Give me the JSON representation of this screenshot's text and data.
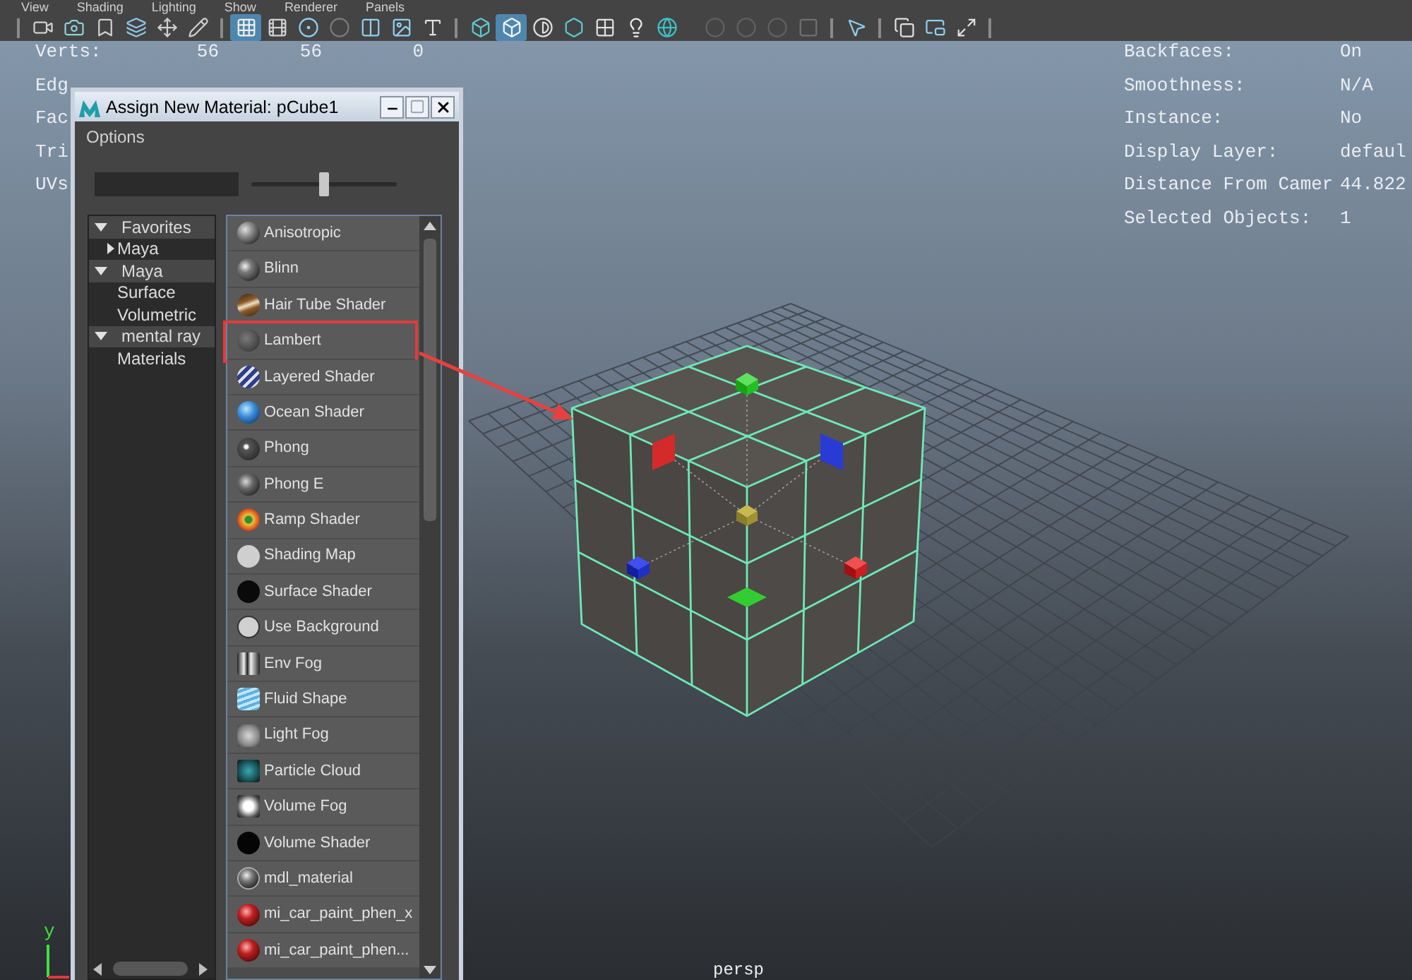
{
  "menu_bar": [
    "View",
    "Shading",
    "Lighting",
    "Show",
    "Renderer",
    "Panels"
  ],
  "toolbar": {
    "buttons": [
      {
        "on": false,
        "disabled": false
      },
      {
        "on": false,
        "disabled": false
      },
      {
        "on": false,
        "disabled": false
      },
      {
        "on": false,
        "disabled": false
      },
      {
        "on": false,
        "disabled": false
      },
      {
        "on": false,
        "disabled": false
      },
      {
        "on": true,
        "disabled": false
      },
      {
        "on": false,
        "disabled": false
      },
      {
        "on": false,
        "disabled": false
      },
      {
        "on": false,
        "disabled": false
      },
      {
        "on": false,
        "disabled": false
      },
      {
        "on": false,
        "disabled": false
      },
      {
        "on": false,
        "disabled": false
      },
      {
        "on": false,
        "disabled": false
      },
      {
        "on": true,
        "disabled": false
      },
      {
        "on": false,
        "disabled": false
      },
      {
        "on": false,
        "disabled": false
      },
      {
        "on": false,
        "disabled": false
      },
      {
        "on": false,
        "disabled": false
      },
      {
        "on": false,
        "disabled": false
      },
      {
        "on": false,
        "disabled": true
      },
      {
        "on": false,
        "disabled": true
      },
      {
        "on": false,
        "disabled": true
      },
      {
        "on": false,
        "disabled": false
      },
      {
        "on": false,
        "disabled": false
      },
      {
        "on": false,
        "disabled": false
      },
      {
        "on": false,
        "disabled": false
      },
      {
        "on": false,
        "disabled": false
      }
    ]
  },
  "viewport": {
    "hud_left": {
      "rows": [
        {
          "label": "Verts:",
          "values": [
            "56",
            "56",
            "0"
          ]
        },
        {
          "label": "Edg"
        },
        {
          "label": "Fac"
        },
        {
          "label": "Tri"
        },
        {
          "label": "UVs"
        }
      ]
    },
    "hud_right": {
      "rows": [
        {
          "label": "Backfaces:",
          "value": "On"
        },
        {
          "label": "Smoothness:",
          "value": "N/A"
        },
        {
          "label": "Instance:",
          "value": "No"
        },
        {
          "label": "Display Layer:",
          "value": "defaul"
        },
        {
          "label": "Distance From Camer",
          "value": "44.822"
        },
        {
          "label": "Selected Objects:",
          "value": "1"
        }
      ]
    },
    "axis_label": "y",
    "camera_label": "persp"
  },
  "dialog": {
    "title": "Assign New Material: pCube1",
    "menu": [
      "Options"
    ],
    "slider": {
      "level": 0.5
    },
    "tree": [
      {
        "label": "Favorites",
        "expanded": true,
        "children": [
          {
            "label": "Maya",
            "expanded": false
          }
        ]
      },
      {
        "label": "Maya",
        "expanded": true,
        "children": [
          {
            "label": "Surface"
          },
          {
            "label": "Volumetric"
          }
        ]
      },
      {
        "label": "mental ray",
        "expanded": true,
        "children": [
          {
            "label": "Materials"
          }
        ]
      }
    ],
    "materials": [
      {
        "label": "Anisotropic",
        "outlined": false
      },
      {
        "label": "Blinn",
        "outlined": false
      },
      {
        "label": "Hair Tube Shader",
        "outlined": false
      },
      {
        "label": "Lambert",
        "outlined": true
      },
      {
        "label": "Layered Shader",
        "outlined": false
      },
      {
        "label": "Ocean Shader",
        "outlined": false
      },
      {
        "label": "Phong",
        "outlined": false
      },
      {
        "label": "Phong E",
        "outlined": false
      },
      {
        "label": "Ramp Shader",
        "outlined": false
      },
      {
        "label": "Shading Map",
        "outlined": false
      },
      {
        "label": "Surface Shader",
        "outlined": false
      },
      {
        "label": "Use Background",
        "outlined": false
      },
      {
        "label": "Env Fog",
        "outlined": false
      },
      {
        "label": "Fluid Shape",
        "outlined": false
      },
      {
        "label": "Light Fog",
        "outlined": false
      },
      {
        "label": "Particle Cloud",
        "outlined": false
      },
      {
        "label": "Volume Fog",
        "outlined": false
      },
      {
        "label": "Volume Shader",
        "outlined": false
      },
      {
        "label": "mdl_material",
        "outlined": false
      },
      {
        "label": "mi_car_paint_phen_x",
        "outlined": false
      },
      {
        "label": "mi_car_paint_phen...",
        "outlined": false
      }
    ]
  }
}
